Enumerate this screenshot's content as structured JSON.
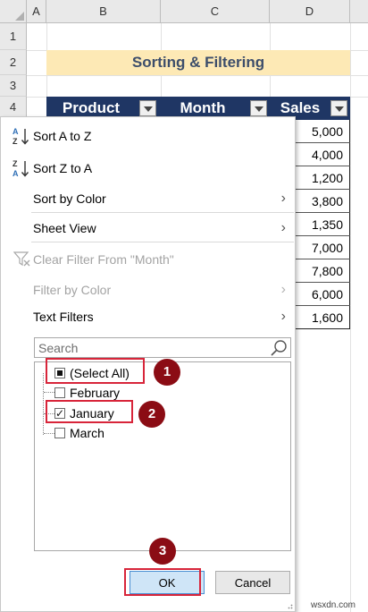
{
  "sheet": {
    "columns": [
      "A",
      "B",
      "C",
      "D"
    ],
    "rows": [
      "1",
      "2",
      "3",
      "4"
    ],
    "title": "Sorting & Filtering",
    "headers": {
      "product": "Product",
      "month": "Month",
      "sales": "Sales"
    },
    "sales_values": [
      "5,000",
      "4,000",
      "1,200",
      "3,800",
      "1,350",
      "7,000",
      "7,800",
      "6,000",
      "1,600"
    ]
  },
  "menu": {
    "sort_az": "Sort A to Z",
    "sort_za": "Sort Z to A",
    "sort_by_color": "Sort by Color",
    "sheet_view": "Sheet View",
    "clear_filter": "Clear Filter From \"Month\"",
    "filter_by_color": "Filter by Color",
    "text_filters": "Text Filters",
    "search_placeholder": "Search",
    "list_items": [
      {
        "label": "(Select All)",
        "state": "partial"
      },
      {
        "label": "February",
        "state": "unchecked"
      },
      {
        "label": "January",
        "state": "checked"
      },
      {
        "label": "March",
        "state": "unchecked"
      }
    ],
    "ok_label": "OK",
    "cancel_label": "Cancel"
  },
  "annotations": {
    "step1": "1",
    "step2": "2",
    "step3": "3"
  },
  "watermark": "wsxdn.com",
  "colors": {
    "header_fill": "#1f3664",
    "title_fill": "#fde9b5",
    "highlight": "#d8253a",
    "badge": "#8b0c14",
    "sort_icon_blue": "#2f6fb6"
  }
}
